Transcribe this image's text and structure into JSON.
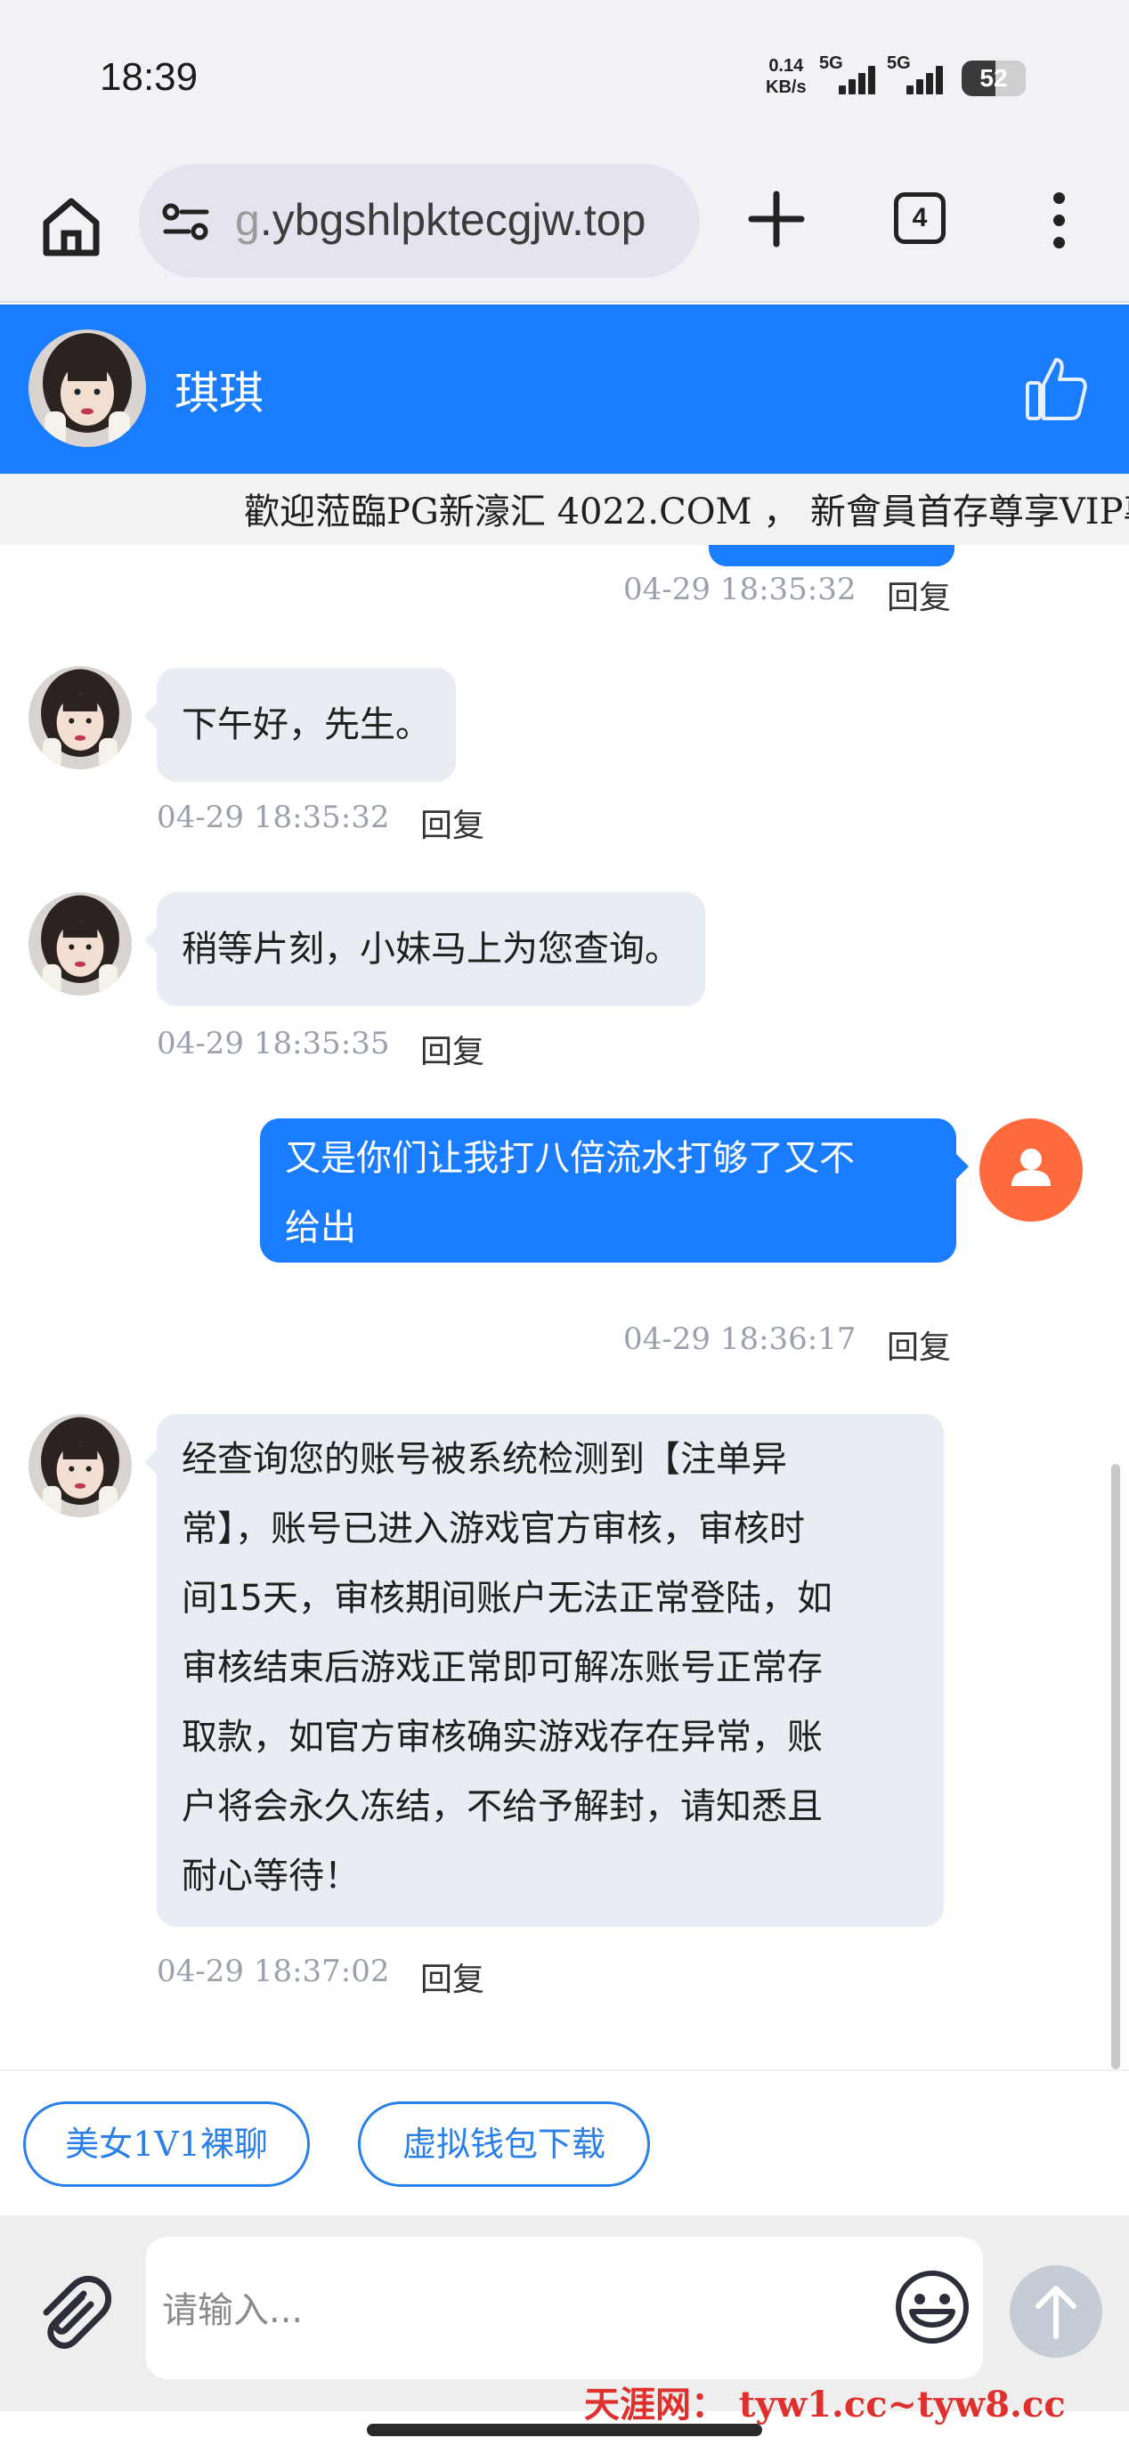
{
  "status_bar": {
    "time": "18:39",
    "net_speed_value": "0.14",
    "net_speed_unit": "KB/s",
    "signal_1_label": "5G",
    "signal_2_label": "5G",
    "battery_level": "52"
  },
  "browser": {
    "url_prefix": "g",
    "url_rest": ".ybgshlpktecgjw.top",
    "tab_count": "4"
  },
  "chat_header": {
    "name": "琪琪"
  },
  "marquee": {
    "text": "歡迎蒞臨PG新濠汇 4022.COM ， 新會員首存尊享VIP專"
  },
  "messages": [
    {
      "side": "out",
      "time": "04-29 18:35:32",
      "reply": "回复"
    },
    {
      "side": "in",
      "text": "下午好，先生。",
      "time": "04-29 18:35:32",
      "reply": "回复"
    },
    {
      "side": "in",
      "text": "稍等片刻，小妹马上为您查询。",
      "time": "04-29 18:35:35",
      "reply": "回复"
    },
    {
      "side": "out",
      "line1": "又是你们让我打八倍流水打够了又不",
      "line2": "给出",
      "time": "04-29 18:36:17",
      "reply": "回复"
    },
    {
      "side": "in",
      "lines": [
        "经查询您的账号被系统检测到【注单异",
        "常】，账号已进入游戏官方审核，审核时",
        "间15天，审核期间账户无法正常登陆，如",
        "审核结束后游戏正常即可解冻账号正常存",
        "取款，如官方审核确实游戏存在异常，账",
        "户将会永久冻结，不给予解封，请知悉且",
        "耐心等待！"
      ],
      "time": "04-29 18:37:02",
      "reply": "回复"
    }
  ],
  "quick_buttons": [
    "美女1V1裸聊",
    "虚拟钱包下载"
  ],
  "input": {
    "placeholder": "请输入..."
  },
  "watermark": "天涯网： tyw1.cc~tyw8.cc",
  "colors": {
    "header_blue": "#1a7cff",
    "incoming_bubble": "#e8ecf3",
    "user_avatar": "#ff6b3d",
    "quick_button": "#2b7fe8",
    "watermark_red": "#e0302d"
  }
}
